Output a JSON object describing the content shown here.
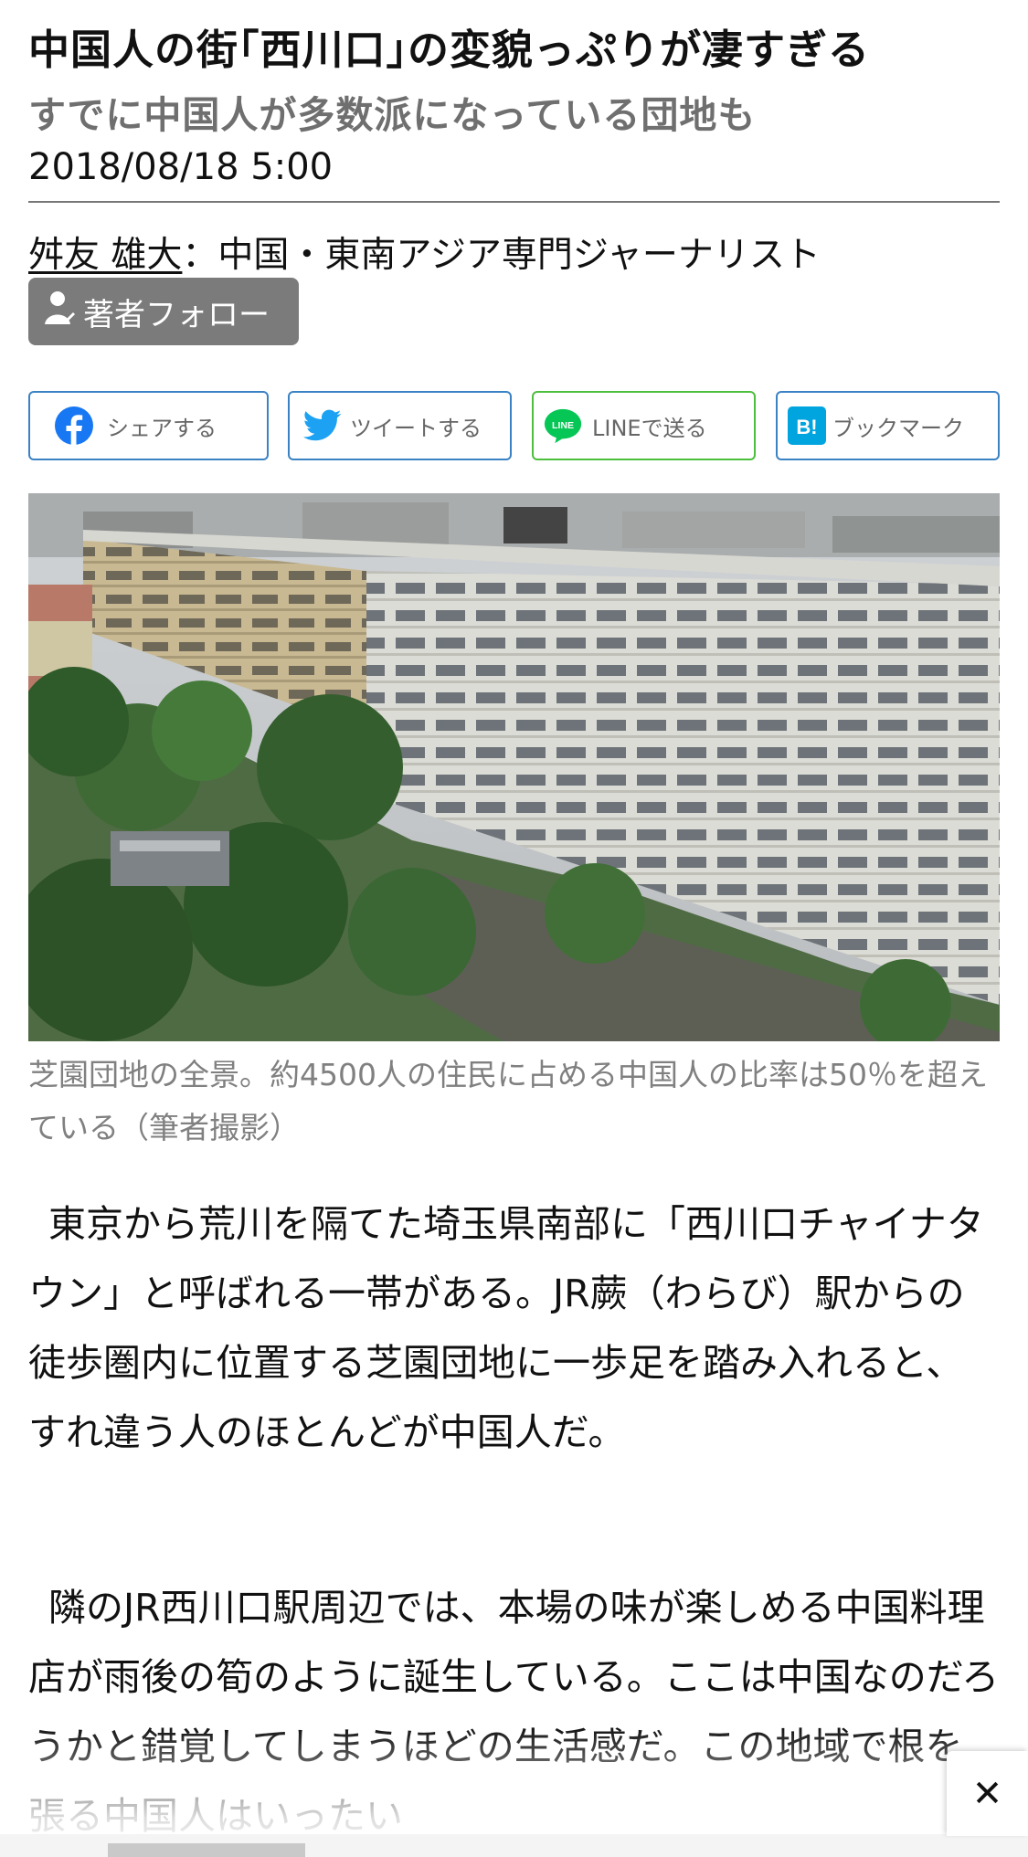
{
  "article": {
    "title": "中国人の街｢西川口｣の変貌っぷりが凄すぎる",
    "subtitle": "すでに中国人が多数派になっている団地も",
    "date": "2018/08/18 5:00",
    "author_name": "舛友 雄大",
    "author_role": "：中国・東南アジア専門ジャーナリスト",
    "follow_label": "著者フォロー"
  },
  "share": {
    "facebook_label": "シェアする",
    "twitter_label": "ツイートする",
    "line_label": "LINEで送る",
    "hatena_label": "ブックマーク",
    "hatena_icon_text": "B!",
    "line_icon_text": "LINE",
    "colors": {
      "facebook": "#1877f2",
      "twitter": "#1da1f2",
      "line": "#06c755",
      "hatena": "#00a4de",
      "border": "#3b82c4",
      "line_border": "#4cbf3c"
    }
  },
  "photo": {
    "caption": "芝園団地の全景。約4500人の住民に占める中国人の比率は50％を超えている（筆者撮影）"
  },
  "body": {
    "paragraph1": "東京から荒川を隔てた埼玉県南部に「西川口チャイナタウン」と呼ばれる一帯がある。JR蕨（わらび）駅からの徒歩圏内に位置する芝園団地に一歩足を踏み入れると、すれ違う人のほとんどが中国人だ。",
    "paragraph2": "隣のJR西川口駅周辺では、本場の味が楽しめる中国料理店が雨後の筍のように誕生している。ここは中国なのだろうかと錯覚してしまうほどの生活感だ。この地域で根を張る中国人はいったい"
  },
  "overlay": {
    "close_symbol": "✕"
  }
}
